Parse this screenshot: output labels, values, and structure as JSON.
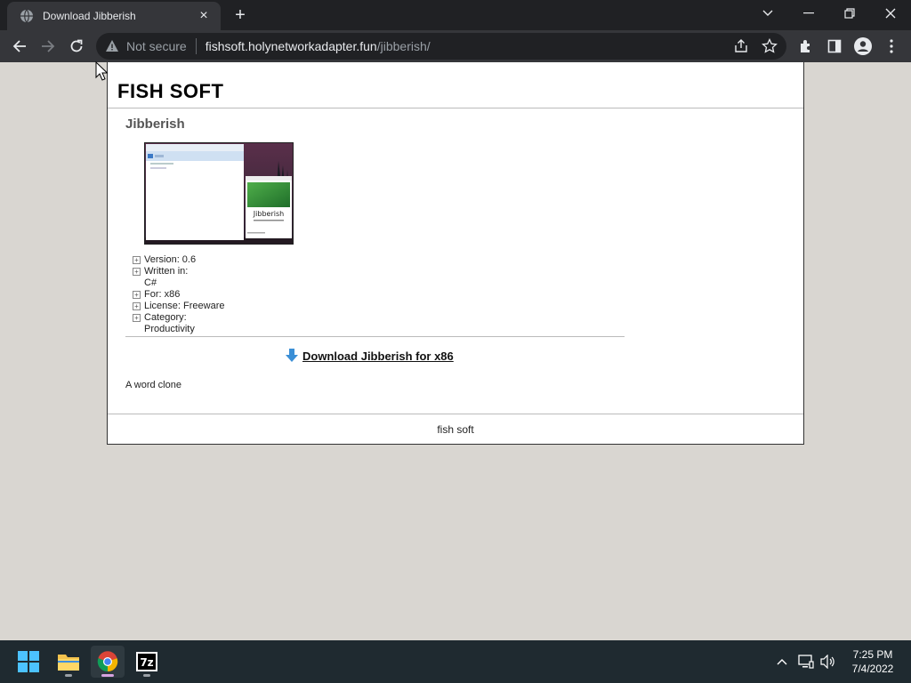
{
  "browser": {
    "tab_title": "Download Jibberish",
    "tab_close": "×",
    "new_tab": "+",
    "security_label": "Not secure",
    "url_host": "fishsoft.holynetworkadapter.fun",
    "url_path": "/jibberish/"
  },
  "page": {
    "site_title": "FISH SOFT",
    "app_title": "Jibberish",
    "screenshot_caption": "Jibberish",
    "info": [
      {
        "label": "Version: 0.6"
      },
      {
        "label": "Written in: C#"
      },
      {
        "label": "For: x86"
      },
      {
        "label": "License: Freeware"
      },
      {
        "label": "Category: Productivity"
      }
    ],
    "download_label": "Download Jibberish for x86",
    "description": "A word clone",
    "footer": "fish soft"
  },
  "taskbar": {
    "time": "7:25 PM",
    "date": "7/4/2022",
    "apps": [
      "start",
      "file-explorer",
      "chrome",
      "7zip"
    ],
    "sevenzip_label": "7z"
  },
  "colors": {
    "chrome_dark": "#202124",
    "chrome_toolbar": "#35363a",
    "page_bg": "#d9d6d1",
    "taskbar_bg": "#1f2a30",
    "download_arrow": "#3b8fd6"
  }
}
